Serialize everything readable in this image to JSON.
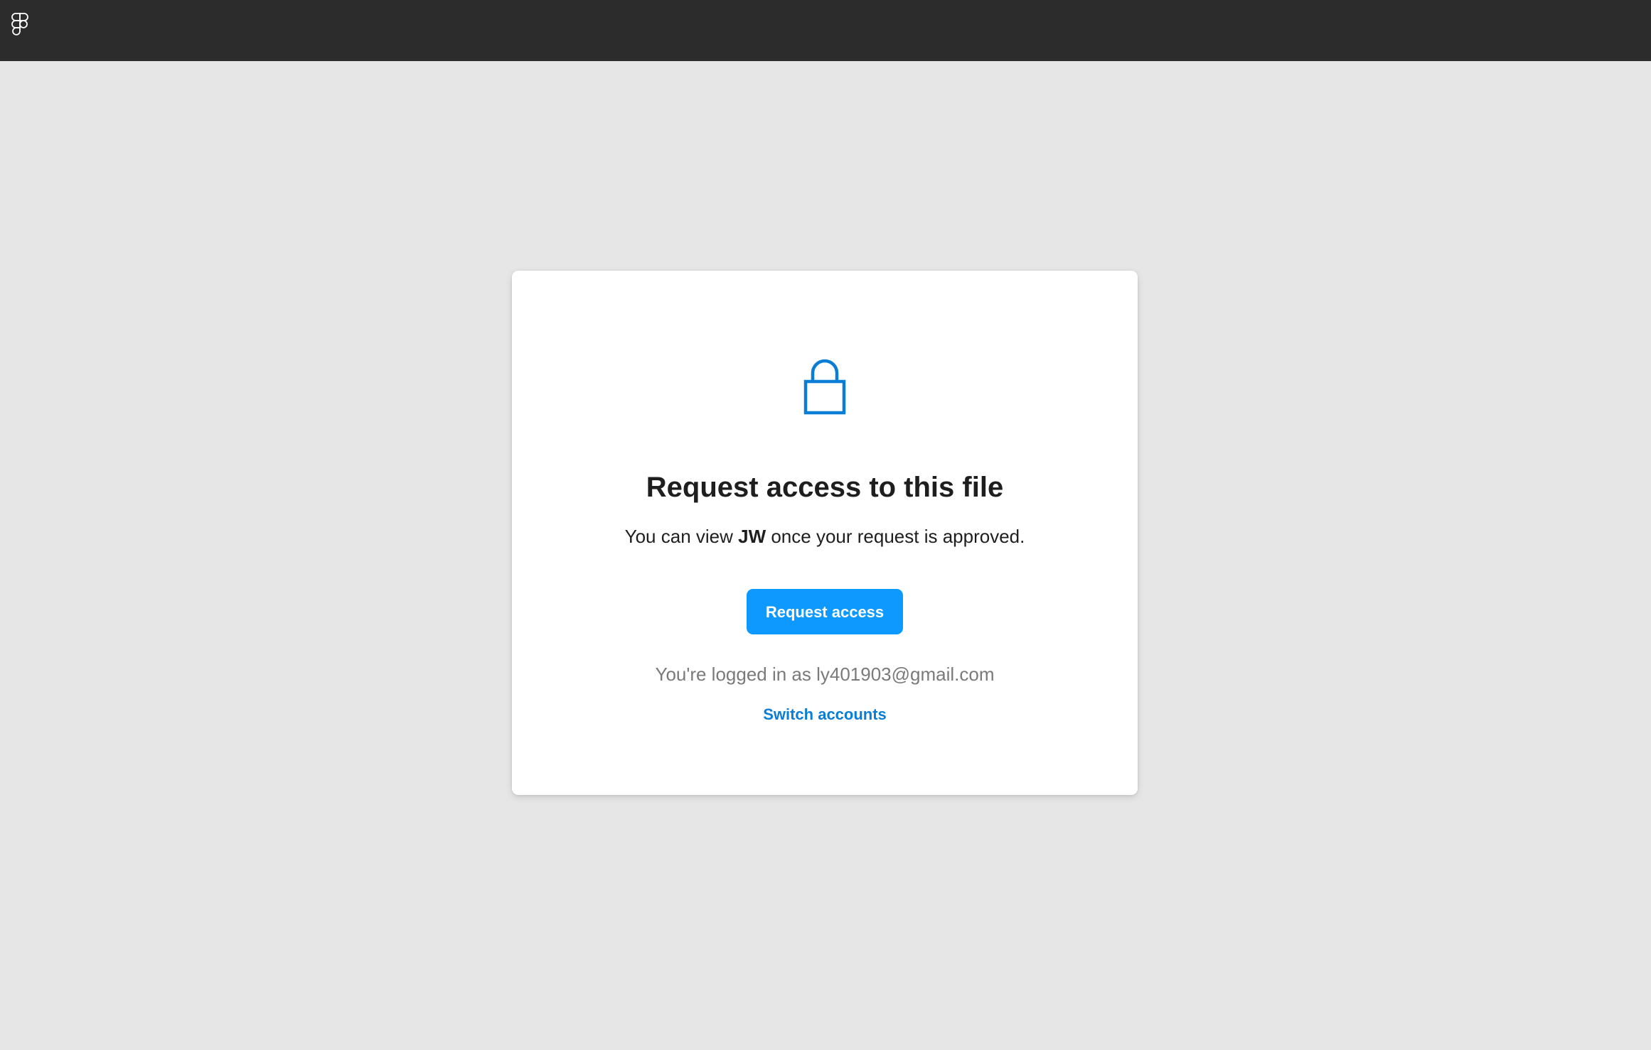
{
  "topbar": {
    "logo_icon": "figma-logo-icon",
    "background_color": "#2c2c2c"
  },
  "dialog": {
    "lock_icon": "lock-icon",
    "accent_color": "#0d99ff",
    "title": "Request access to this file",
    "subtitle_prefix": "You can view ",
    "file_name": "JW",
    "subtitle_suffix": " once your request is approved.",
    "request_button_label": "Request access",
    "logged_in_text": "You're logged in as ly401903@gmail.com",
    "switch_accounts_label": "Switch accounts"
  }
}
